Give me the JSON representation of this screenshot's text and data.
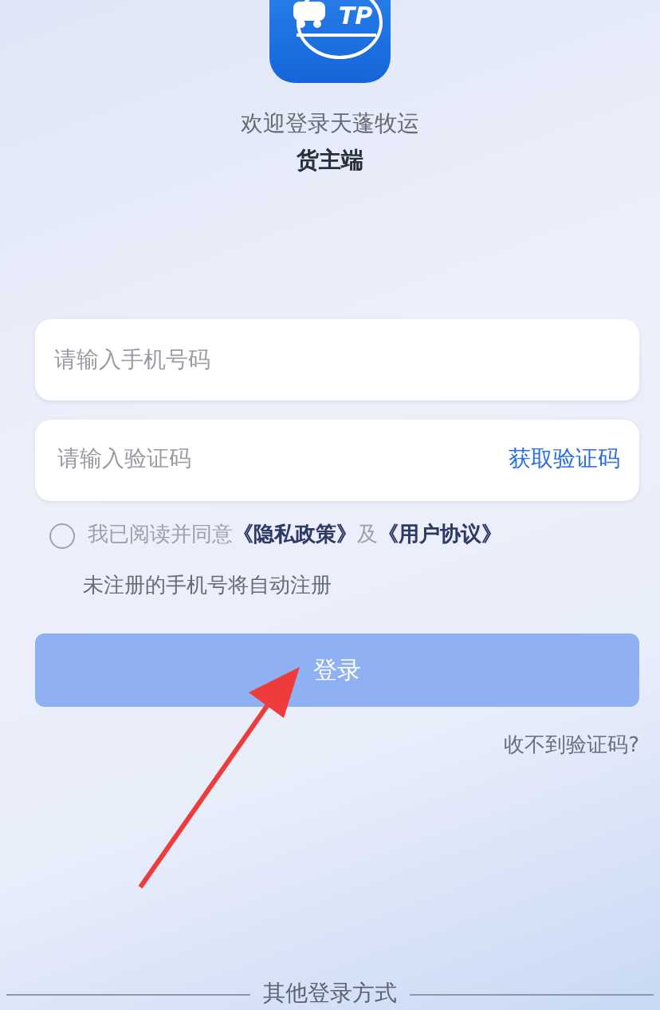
{
  "logo": {
    "text": "TP"
  },
  "welcome": "欢迎登录天蓬牧运",
  "subtitle": "货主端",
  "phone_field": {
    "placeholder": "请输入手机号码"
  },
  "code_field": {
    "placeholder": "请输入验证码",
    "action": "获取验证码"
  },
  "agreement": {
    "checked": false,
    "prefix": "我已阅读并同意",
    "links": [
      "《隐私政策》",
      "《用户协议》"
    ],
    "joiner": "及"
  },
  "note": "未注册的手机号将自动注册",
  "login_button": {
    "label": "登录",
    "disabled": true
  },
  "help_link": "收不到验证码?",
  "other_login": "其他登录方式"
}
